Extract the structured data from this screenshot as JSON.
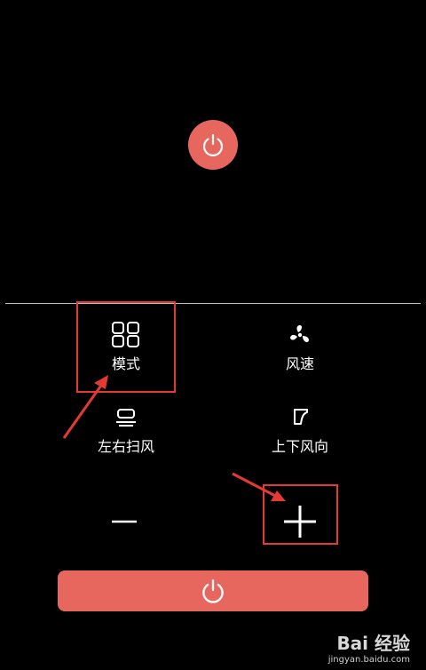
{
  "power": {
    "icon": "power-icon"
  },
  "controls": {
    "mode": {
      "label": "模式",
      "icon": "grid-four-icon"
    },
    "fan_speed": {
      "label": "风速",
      "icon": "fan-icon"
    },
    "swing_horizontal": {
      "label": "左右扫风",
      "icon": "horizontal-swing-icon"
    },
    "swing_vertical": {
      "label": "上下风向",
      "icon": "vertical-swing-icon"
    }
  },
  "stepper": {
    "minus_icon": "minus-icon",
    "plus_icon": "plus-icon"
  },
  "bottom_button": {
    "icon": "power-icon"
  },
  "annotations": {
    "color": "#E53935"
  },
  "colors": {
    "accent": "#E7675E",
    "background": "#000000"
  },
  "watermark": {
    "logo": "Bai 经验",
    "url": "jingyan.baidu.com"
  }
}
